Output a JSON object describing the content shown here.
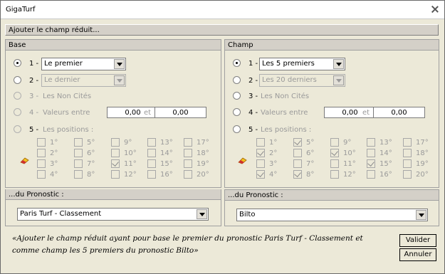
{
  "window": {
    "title": "GigaTurf"
  },
  "header": {
    "label": "Ajouter le champ réduit..."
  },
  "base": {
    "title": "Base",
    "opt1": {
      "num": "1 -",
      "value": "Le premier"
    },
    "opt2": {
      "num": "2 -",
      "value": "Le dernier"
    },
    "opt3": {
      "num": "3 -",
      "label": "Les Non Cités"
    },
    "opt4": {
      "num": "4 -",
      "label": "Valeurs entre",
      "v1": "0,00",
      "and": "et",
      "v2": "0,00"
    },
    "opt5": {
      "num": "5 -",
      "label": "Les positions :"
    },
    "positions": [
      "1°",
      "5°",
      "9°",
      "13°",
      "17°",
      "2°",
      "6°",
      "10°",
      "14°",
      "18°",
      "3°",
      "7°",
      "11°",
      "15°",
      "19°",
      "4°",
      "8°",
      "12°",
      "16°",
      "20°"
    ],
    "checked": [
      false,
      false,
      false,
      false,
      false,
      false,
      false,
      false,
      false,
      false,
      false,
      false,
      true,
      false,
      false,
      false,
      false,
      false,
      false,
      false
    ],
    "pronostic_title": "...du Pronostic :",
    "pronostic_value": "Paris Turf - Classement"
  },
  "champ": {
    "title": "Champ",
    "opt1": {
      "num": "1 -",
      "value": "Les 5 premiers"
    },
    "opt2": {
      "num": "2 -",
      "value": "Les 20 derniers"
    },
    "opt3": {
      "num": "3 -",
      "label": "Les Non Cités"
    },
    "opt4": {
      "num": "4 -",
      "label": "Valeurs entre",
      "v1": "0,00",
      "and": "et",
      "v2": "0,00"
    },
    "opt5": {
      "num": "5 -",
      "label": "Les positions :"
    },
    "positions": [
      "1°",
      "5°",
      "9°",
      "13°",
      "17°",
      "2°",
      "6°",
      "10°",
      "14°",
      "18°",
      "3°",
      "7°",
      "11°",
      "15°",
      "19°",
      "4°",
      "8°",
      "12°",
      "16°",
      "20°"
    ],
    "checked": [
      false,
      true,
      false,
      false,
      false,
      true,
      false,
      true,
      false,
      false,
      false,
      false,
      false,
      true,
      false,
      true,
      true,
      false,
      false,
      false
    ],
    "pronostic_title": "...du Pronostic :",
    "pronostic_value": "Bilto"
  },
  "message": "«Ajouter le champ réduit  ayant pour base le premier du pronostic Paris Turf - Classement et comme champ les 5 premiers du pronostic Bilto»",
  "buttons": {
    "validate": "Valider",
    "cancel": "Annuler"
  }
}
